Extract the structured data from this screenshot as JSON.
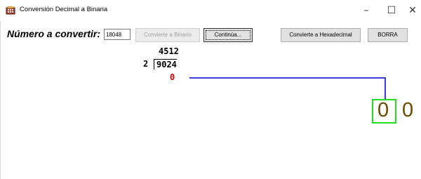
{
  "window": {
    "title": "Conversión Decimal a Binaria",
    "controls": {
      "minimize": "–",
      "maximize": "☐",
      "close": "✕"
    }
  },
  "form": {
    "prompt_label": "Número a convertir:",
    "number_value": "18048"
  },
  "buttons": {
    "convert_binary": "Convierte a Binario",
    "continue": "Continúa...",
    "convert_hex": "Convierte a Hexadecimal",
    "clear": "BORRA"
  },
  "division": {
    "quotient": "4512",
    "divisor": "2",
    "dividend": "9024",
    "remainder": "0"
  },
  "binary_digits": {
    "current": "0",
    "previous": "0"
  },
  "colors": {
    "remainder": "#e00000",
    "connector": "#3b3bdc",
    "digit_highlight": "#22dd22",
    "digit": "#6b4a00"
  }
}
